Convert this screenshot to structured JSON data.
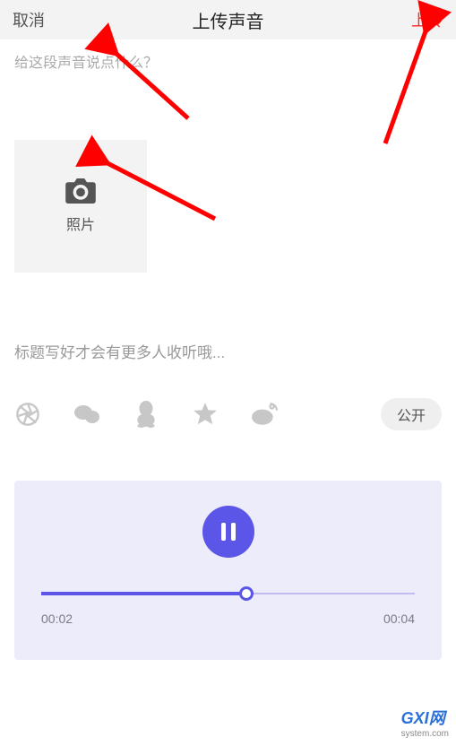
{
  "header": {
    "cancel": "取消",
    "title": "上传声音",
    "upload": "上传"
  },
  "description": {
    "placeholder": "给这段声音说点什么？",
    "value": ""
  },
  "photo": {
    "label": "照片"
  },
  "title_input": {
    "placeholder": "标题写好才会有更多人收听哦...",
    "value": ""
  },
  "share": {
    "icons": [
      "aperture",
      "wechat",
      "qq",
      "qzone",
      "weibo"
    ],
    "public_label": "公开"
  },
  "player": {
    "state": "playing",
    "current_time": "00:02",
    "total_time": "00:04",
    "progress_percent": 55
  },
  "watermark": {
    "brand1": "G",
    "brand2": "XI",
    "brand3": "网",
    "sub": "system.com"
  }
}
